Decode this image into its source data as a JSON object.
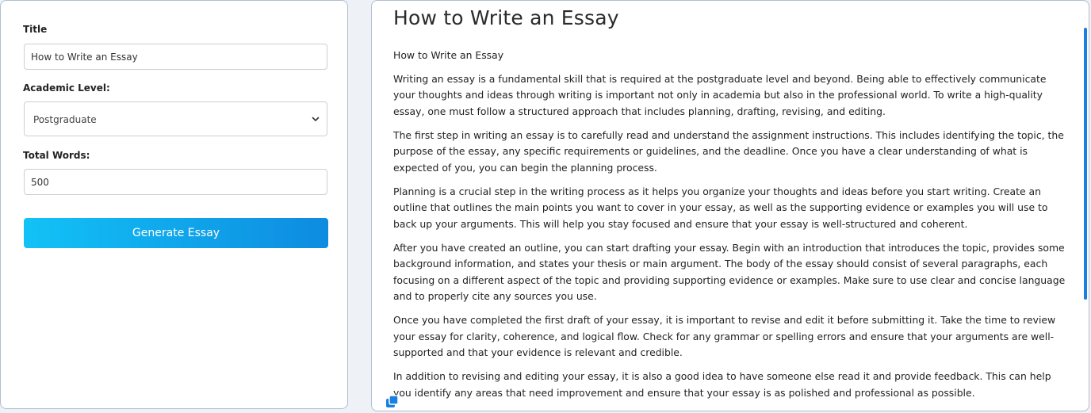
{
  "form": {
    "title_label": "Title",
    "title_value": "How to Write an Essay",
    "level_label": "Academic Level:",
    "level_value": "Postgraduate",
    "words_label": "Total Words:",
    "words_value": "500",
    "generate_label": "Generate Essay"
  },
  "essay": {
    "title": "How to Write an Essay",
    "heading": "How to Write an Essay",
    "paragraphs": [
      "Writing an essay is a fundamental skill that is required at the postgraduate level and beyond. Being able to effectively communicate your thoughts and ideas through writing is important not only in academia but also in the professional world. To write a high-quality essay, one must follow a structured approach that includes planning, drafting, revising, and editing.",
      "The first step in writing an essay is to carefully read and understand the assignment instructions. This includes identifying the topic, the purpose of the essay, any specific requirements or guidelines, and the deadline. Once you have a clear understanding of what is expected of you, you can begin the planning process.",
      "Planning is a crucial step in the writing process as it helps you organize your thoughts and ideas before you start writing. Create an outline that outlines the main points you want to cover in your essay, as well as the supporting evidence or examples you will use to back up your arguments. This will help you stay focused and ensure that your essay is well-structured and coherent.",
      "After you have created an outline, you can start drafting your essay. Begin with an introduction that introduces the topic, provides some background information, and states your thesis or main argument. The body of the essay should consist of several paragraphs, each focusing on a different aspect of the topic and providing supporting evidence or examples. Make sure to use clear and concise language and to properly cite any sources you use.",
      "Once you have completed the first draft of your essay, it is important to revise and edit it before submitting it. Take the time to review your essay for clarity, coherence, and logical flow. Check for any grammar or spelling errors and ensure that your arguments are well-supported and that your evidence is relevant and credible.",
      "In addition to revising and editing your essay, it is also a good idea to have someone else read it and provide feedback. This can help you identify any areas that need improvement and ensure that your essay is as polished and professional as possible."
    ]
  },
  "icons": {
    "select_chevron": "chevron-down-icon",
    "copy": "copy-icon"
  },
  "colors": {
    "accent_start": "#12c2f6",
    "accent_end": "#0e8be0",
    "scrollbar": "#1a7fe0",
    "panel_border": "#aebfd2"
  }
}
